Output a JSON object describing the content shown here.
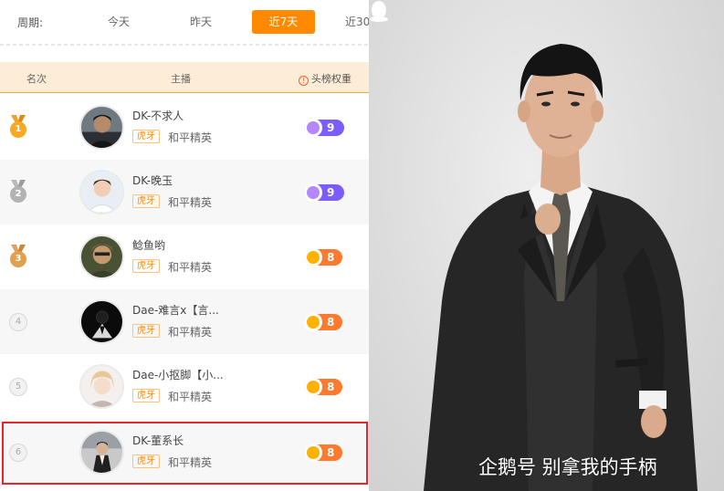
{
  "period": {
    "label": "周期:",
    "tabs": [
      {
        "label": "今天",
        "active": false
      },
      {
        "label": "昨天",
        "active": false
      },
      {
        "label": "近7天",
        "active": true
      },
      {
        "label": "近30",
        "active": false
      }
    ]
  },
  "table": {
    "headers": {
      "rank": "名次",
      "host": "主播",
      "weight": "头榜权重"
    },
    "rows": [
      {
        "rank": "1",
        "name": "DK-不求人",
        "platform": "虎牙",
        "game": "和平精英",
        "weight": "9",
        "badge": "purple"
      },
      {
        "rank": "2",
        "name": "DK-晚玉",
        "platform": "虎牙",
        "game": "和平精英",
        "weight": "9",
        "badge": "purple"
      },
      {
        "rank": "3",
        "name": "鲶鱼哟",
        "platform": "虎牙",
        "game": "和平精英",
        "weight": "8",
        "badge": "orange"
      },
      {
        "rank": "4",
        "name": "Dae-难言x【言...",
        "platform": "虎牙",
        "game": "和平精英",
        "weight": "8",
        "badge": "orange"
      },
      {
        "rank": "5",
        "name": "Dae-小抠脚【小...",
        "platform": "虎牙",
        "game": "和平精英",
        "weight": "8",
        "badge": "orange"
      },
      {
        "rank": "6",
        "name": "DK-董系长",
        "platform": "虎牙",
        "game": "和平精英",
        "weight": "8",
        "badge": "orange"
      }
    ]
  },
  "photo": {
    "watermark": "企鹅号 别拿我的手柄"
  },
  "colors": {
    "accent": "#ff8a00",
    "highlight": "#e5262b",
    "badge_purple": "#7b5cff",
    "badge_orange": "#ff7a2e"
  }
}
